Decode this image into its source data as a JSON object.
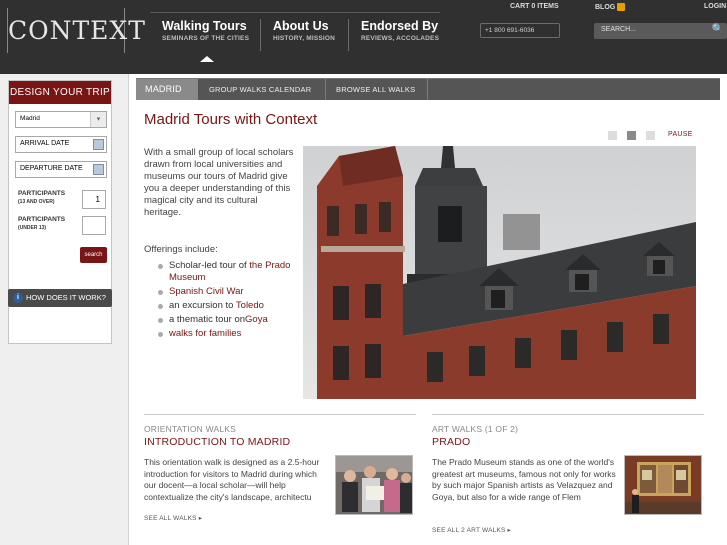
{
  "header": {
    "logo": "CONTEXT",
    "nav": [
      {
        "title": "Walking Tours",
        "sub": "SEMINARS OF THE CITIES"
      },
      {
        "title": "About Us",
        "sub": "HISTORY, MISSION"
      },
      {
        "title": "Endorsed By",
        "sub": "REVIEWS, ACCOLADES"
      }
    ],
    "cart": "CART 0 ITEMS",
    "blog": "BLOG",
    "login": "LOGIN",
    "phone": "+1 800 691-6036",
    "search_placeholder": "SEARCH...",
    "search_icon": "🔍"
  },
  "sidebar": {
    "heading": "DESIGN YOUR TRIP",
    "city_value": "Madrid",
    "city_arrow": "▾",
    "arrival_label": "ARRIVAL DATE",
    "departure_label": "DEPARTURE DATE",
    "participants_label": "PARTICIPANTS",
    "participants_sub": "(13 AND OVER)",
    "participants_value": "1",
    "under_label": "PARTICIPANTS",
    "under_sub": "(UNDER 13)",
    "under_value": "",
    "search_button": "search",
    "how_it_works_icon": "i",
    "how_it_works": "HOW DOES IT WORK?"
  },
  "subnav": {
    "tabs": [
      "MADRID",
      "GROUP WALKS CALENDAR",
      "BROWSE ALL WALKS"
    ]
  },
  "main": {
    "title": "Madrid Tours with Context",
    "pause": "PAUSE",
    "intro": "With a small group of local scholars drawn from local universities and museums our tours of Madrid give you a deeper understanding of this magical city and its cultural heritage.",
    "offerings_label": "Offerings include:",
    "offerings": [
      {
        "prefix": "Scholar-led tour of ",
        "link": "the Prado Museum"
      },
      {
        "prefix": "",
        "link": "Spanish Civil War"
      },
      {
        "prefix": "an excursion to ",
        "link": "Toledo"
      },
      {
        "prefix": "a thematic tour on",
        "link": "Goya"
      },
      {
        "prefix": "",
        "link": "walks for families"
      }
    ]
  },
  "walks": [
    {
      "category": "ORIENTATION WALKS",
      "title": "INTRODUCTION TO MADRID",
      "text": "This orientation walk is designed as a 2.5-hour introduction for visitors to Madrid during which our docent—a local scholar—will help contextualize the city's landscape, architectu",
      "see_all": "SEE ALL WALKS ▸"
    },
    {
      "category": "ART WALKS (1 OF 2)",
      "title": "PRADO",
      "text": "The Prado Museum stands as one of the world's greatest art museums, famous not only for works by such major Spanish artists as Velazquez and Goya, but also for a wide range of Flem",
      "see_all": "SEE ALL 2 ART WALKS ▸"
    }
  ],
  "colors": {
    "brand": "#7a1515",
    "header_bg": "#303030",
    "subnav_bg": "#555555"
  }
}
